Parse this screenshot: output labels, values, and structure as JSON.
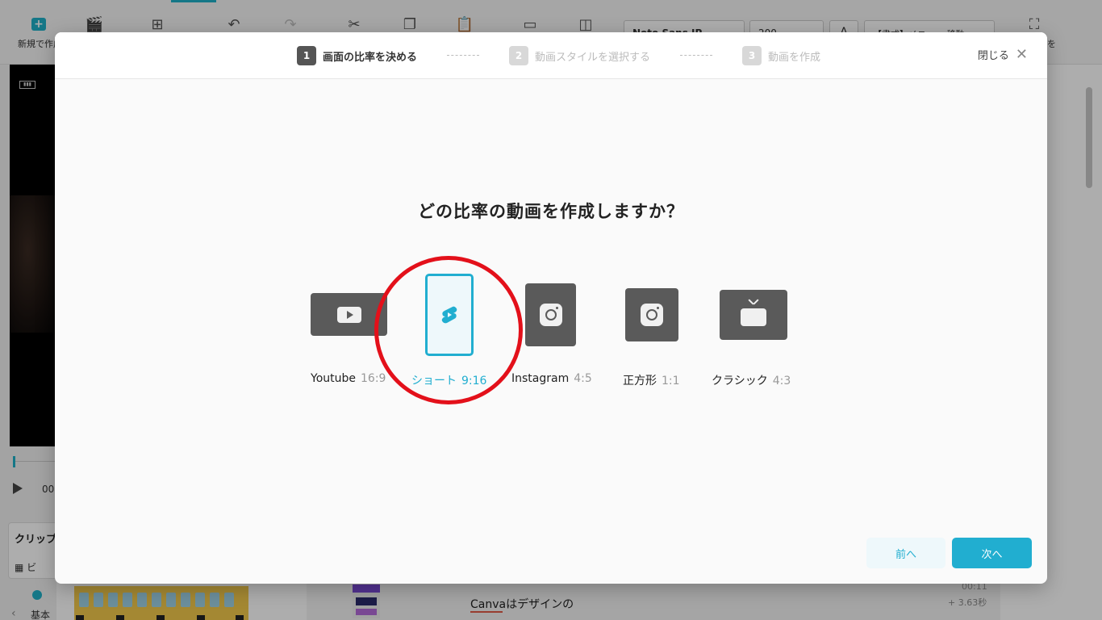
{
  "background": {
    "toolbar": {
      "new_label": "新規で作成",
      "font_select_value": "Noto Sans JP",
      "size_select_value": "200",
      "color_button_label": "A",
      "format_select_value": "【書式】メニュー 移動",
      "right_label": "を"
    },
    "player": {
      "time_fragment": "00"
    },
    "clip_panel": {
      "title": "クリップ",
      "row_label": "ビ"
    },
    "bottom_tab": {
      "label": "基本"
    },
    "list_item": {
      "text": "Canvaはデザインの",
      "time": "00:11",
      "duration": "+ 3.63秒"
    }
  },
  "modal": {
    "steps": [
      {
        "number": "1",
        "label": "画面の比率を決める",
        "active": true
      },
      {
        "number": "2",
        "label": "動画スタイルを選択する",
        "active": false
      },
      {
        "number": "3",
        "label": "動画を作成",
        "active": false
      }
    ],
    "close_label": "閉じる",
    "question": "どの比率の動画を作成しますか？",
    "options": [
      {
        "name": "Youtube",
        "ratio": "16:9",
        "icon": "youtube-icon",
        "selected": false
      },
      {
        "name": "ショート",
        "ratio": "9:16",
        "icon": "shorts-icon",
        "selected": true
      },
      {
        "name": "Instagram",
        "ratio": "4:5",
        "icon": "instagram-icon",
        "selected": false
      },
      {
        "name": "正方形",
        "ratio": "1:1",
        "icon": "instagram-icon",
        "selected": false
      },
      {
        "name": "クラシック",
        "ratio": "4:3",
        "icon": "tv-icon",
        "selected": false
      }
    ],
    "prev_label": "前へ",
    "next_label": "次へ"
  },
  "colors": {
    "accent": "#21aed0",
    "icon_gray": "#5a5a5a",
    "annotation_red": "#e3101a"
  }
}
